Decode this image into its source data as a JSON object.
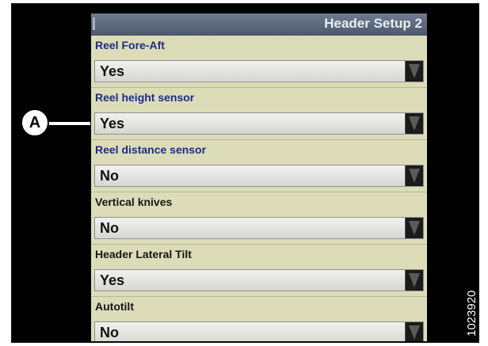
{
  "screen": {
    "title": "Header Setup 2",
    "fields": [
      {
        "label": "Reel Fore-Aft",
        "value": "Yes"
      },
      {
        "label": "Reel height sensor",
        "value": "Yes"
      },
      {
        "label": "Reel distance sensor",
        "value": "No"
      },
      {
        "label": "Vertical knives",
        "value": "No"
      },
      {
        "label": "Header Lateral Tilt",
        "value": "Yes"
      },
      {
        "label": "Autotilt",
        "value": "No"
      }
    ]
  },
  "callout": {
    "label": "A"
  },
  "figure_number": "1023920",
  "colors": {
    "label_blue": "#1c2d86",
    "screen_bg": "#dcdcb8",
    "titlebar": "#5a6578"
  }
}
